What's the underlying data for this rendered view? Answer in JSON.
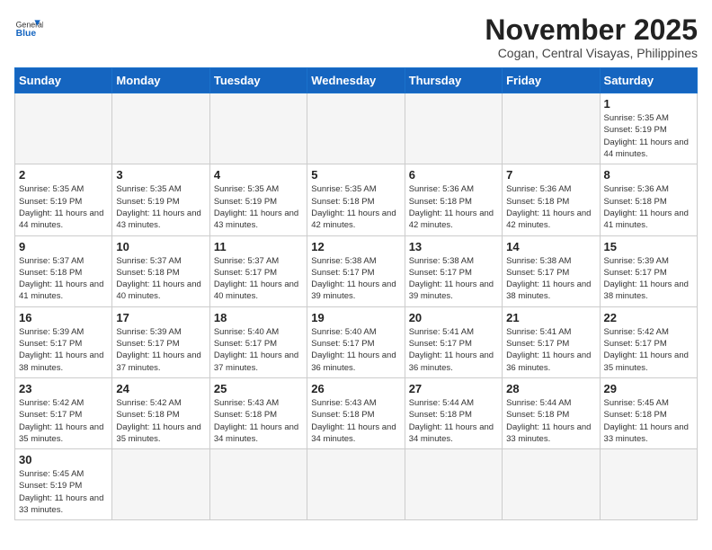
{
  "header": {
    "logo": {
      "general_label": "General",
      "blue_label": "Blue"
    },
    "title": "November 2025",
    "location": "Cogan, Central Visayas, Philippines"
  },
  "days_of_week": [
    "Sunday",
    "Monday",
    "Tuesday",
    "Wednesday",
    "Thursday",
    "Friday",
    "Saturday"
  ],
  "weeks": [
    {
      "days": [
        {
          "num": "",
          "empty": true
        },
        {
          "num": "",
          "empty": true
        },
        {
          "num": "",
          "empty": true
        },
        {
          "num": "",
          "empty": true
        },
        {
          "num": "",
          "empty": true
        },
        {
          "num": "",
          "empty": true
        },
        {
          "num": "1",
          "sunrise": "Sunrise: 5:35 AM",
          "sunset": "Sunset: 5:19 PM",
          "daylight": "Daylight: 11 hours and 44 minutes."
        }
      ]
    },
    {
      "days": [
        {
          "num": "2",
          "sunrise": "Sunrise: 5:35 AM",
          "sunset": "Sunset: 5:19 PM",
          "daylight": "Daylight: 11 hours and 44 minutes."
        },
        {
          "num": "3",
          "sunrise": "Sunrise: 5:35 AM",
          "sunset": "Sunset: 5:19 PM",
          "daylight": "Daylight: 11 hours and 43 minutes."
        },
        {
          "num": "4",
          "sunrise": "Sunrise: 5:35 AM",
          "sunset": "Sunset: 5:19 PM",
          "daylight": "Daylight: 11 hours and 43 minutes."
        },
        {
          "num": "5",
          "sunrise": "Sunrise: 5:35 AM",
          "sunset": "Sunset: 5:18 PM",
          "daylight": "Daylight: 11 hours and 42 minutes."
        },
        {
          "num": "6",
          "sunrise": "Sunrise: 5:36 AM",
          "sunset": "Sunset: 5:18 PM",
          "daylight": "Daylight: 11 hours and 42 minutes."
        },
        {
          "num": "7",
          "sunrise": "Sunrise: 5:36 AM",
          "sunset": "Sunset: 5:18 PM",
          "daylight": "Daylight: 11 hours and 42 minutes."
        },
        {
          "num": "8",
          "sunrise": "Sunrise: 5:36 AM",
          "sunset": "Sunset: 5:18 PM",
          "daylight": "Daylight: 11 hours and 41 minutes."
        }
      ]
    },
    {
      "days": [
        {
          "num": "9",
          "sunrise": "Sunrise: 5:37 AM",
          "sunset": "Sunset: 5:18 PM",
          "daylight": "Daylight: 11 hours and 41 minutes."
        },
        {
          "num": "10",
          "sunrise": "Sunrise: 5:37 AM",
          "sunset": "Sunset: 5:18 PM",
          "daylight": "Daylight: 11 hours and 40 minutes."
        },
        {
          "num": "11",
          "sunrise": "Sunrise: 5:37 AM",
          "sunset": "Sunset: 5:17 PM",
          "daylight": "Daylight: 11 hours and 40 minutes."
        },
        {
          "num": "12",
          "sunrise": "Sunrise: 5:38 AM",
          "sunset": "Sunset: 5:17 PM",
          "daylight": "Daylight: 11 hours and 39 minutes."
        },
        {
          "num": "13",
          "sunrise": "Sunrise: 5:38 AM",
          "sunset": "Sunset: 5:17 PM",
          "daylight": "Daylight: 11 hours and 39 minutes."
        },
        {
          "num": "14",
          "sunrise": "Sunrise: 5:38 AM",
          "sunset": "Sunset: 5:17 PM",
          "daylight": "Daylight: 11 hours and 38 minutes."
        },
        {
          "num": "15",
          "sunrise": "Sunrise: 5:39 AM",
          "sunset": "Sunset: 5:17 PM",
          "daylight": "Daylight: 11 hours and 38 minutes."
        }
      ]
    },
    {
      "days": [
        {
          "num": "16",
          "sunrise": "Sunrise: 5:39 AM",
          "sunset": "Sunset: 5:17 PM",
          "daylight": "Daylight: 11 hours and 38 minutes."
        },
        {
          "num": "17",
          "sunrise": "Sunrise: 5:39 AM",
          "sunset": "Sunset: 5:17 PM",
          "daylight": "Daylight: 11 hours and 37 minutes."
        },
        {
          "num": "18",
          "sunrise": "Sunrise: 5:40 AM",
          "sunset": "Sunset: 5:17 PM",
          "daylight": "Daylight: 11 hours and 37 minutes."
        },
        {
          "num": "19",
          "sunrise": "Sunrise: 5:40 AM",
          "sunset": "Sunset: 5:17 PM",
          "daylight": "Daylight: 11 hours and 36 minutes."
        },
        {
          "num": "20",
          "sunrise": "Sunrise: 5:41 AM",
          "sunset": "Sunset: 5:17 PM",
          "daylight": "Daylight: 11 hours and 36 minutes."
        },
        {
          "num": "21",
          "sunrise": "Sunrise: 5:41 AM",
          "sunset": "Sunset: 5:17 PM",
          "daylight": "Daylight: 11 hours and 36 minutes."
        },
        {
          "num": "22",
          "sunrise": "Sunrise: 5:42 AM",
          "sunset": "Sunset: 5:17 PM",
          "daylight": "Daylight: 11 hours and 35 minutes."
        }
      ]
    },
    {
      "days": [
        {
          "num": "23",
          "sunrise": "Sunrise: 5:42 AM",
          "sunset": "Sunset: 5:17 PM",
          "daylight": "Daylight: 11 hours and 35 minutes."
        },
        {
          "num": "24",
          "sunrise": "Sunrise: 5:42 AM",
          "sunset": "Sunset: 5:18 PM",
          "daylight": "Daylight: 11 hours and 35 minutes."
        },
        {
          "num": "25",
          "sunrise": "Sunrise: 5:43 AM",
          "sunset": "Sunset: 5:18 PM",
          "daylight": "Daylight: 11 hours and 34 minutes."
        },
        {
          "num": "26",
          "sunrise": "Sunrise: 5:43 AM",
          "sunset": "Sunset: 5:18 PM",
          "daylight": "Daylight: 11 hours and 34 minutes."
        },
        {
          "num": "27",
          "sunrise": "Sunrise: 5:44 AM",
          "sunset": "Sunset: 5:18 PM",
          "daylight": "Daylight: 11 hours and 34 minutes."
        },
        {
          "num": "28",
          "sunrise": "Sunrise: 5:44 AM",
          "sunset": "Sunset: 5:18 PM",
          "daylight": "Daylight: 11 hours and 33 minutes."
        },
        {
          "num": "29",
          "sunrise": "Sunrise: 5:45 AM",
          "sunset": "Sunset: 5:18 PM",
          "daylight": "Daylight: 11 hours and 33 minutes."
        }
      ]
    },
    {
      "days": [
        {
          "num": "30",
          "sunrise": "Sunrise: 5:45 AM",
          "sunset": "Sunset: 5:19 PM",
          "daylight": "Daylight: 11 hours and 33 minutes.",
          "last_row": true
        },
        {
          "num": "",
          "empty": true,
          "last_row": true
        },
        {
          "num": "",
          "empty": true,
          "last_row": true
        },
        {
          "num": "",
          "empty": true,
          "last_row": true
        },
        {
          "num": "",
          "empty": true,
          "last_row": true
        },
        {
          "num": "",
          "empty": true,
          "last_row": true
        },
        {
          "num": "",
          "empty": true,
          "last_row": true
        }
      ]
    }
  ]
}
